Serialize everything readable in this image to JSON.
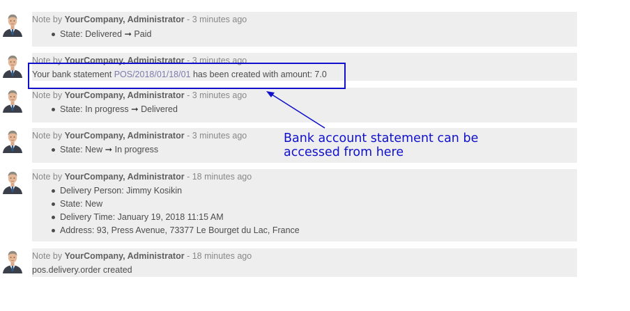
{
  "messages": [
    {
      "prefix": "Note by",
      "author": "YourCompany, Administrator",
      "separator": " - ",
      "time": "3 minutes ago",
      "tracking": [
        {
          "label": "State:",
          "old": "Delivered",
          "arrow": "➞",
          "new": "Paid"
        }
      ]
    },
    {
      "prefix": "Note by",
      "author": "YourCompany, Administrator",
      "separator": " - ",
      "time": "3 minutes ago",
      "body": {
        "before": "Your bank statement",
        "link": "POS/2018/01/18/01",
        "after": "has been created with amount: 7.0"
      }
    },
    {
      "prefix": "Note by",
      "author": "YourCompany, Administrator",
      "separator": " - ",
      "time": "3 minutes ago",
      "tracking": [
        {
          "label": "State:",
          "old": "In progress",
          "arrow": "➞",
          "new": "Delivered"
        }
      ]
    },
    {
      "prefix": "Note by",
      "author": "YourCompany, Administrator",
      "separator": " - ",
      "time": "3 minutes ago",
      "tracking": [
        {
          "label": "State:",
          "old": "New",
          "arrow": "➞",
          "new": "In progress"
        }
      ]
    },
    {
      "prefix": "Note by",
      "author": "YourCompany, Administrator",
      "separator": " - ",
      "time": "18 minutes ago",
      "items": [
        "Delivery Person: Jimmy Kosikin",
        "State: New",
        "Delivery Time: January 19, 2018 11:15 AM",
        "Address: 93, Press Avenue, 73377 Le Bourget du Lac, France"
      ]
    },
    {
      "prefix": "Note by",
      "author": "YourCompany, Administrator",
      "separator": " - ",
      "time": "18 minutes ago",
      "body_plain": "pos.delivery.order created"
    }
  ],
  "annotation": {
    "text": "Bank account statement can be\naccessed from here",
    "color": "#1010cc"
  },
  "colors": {
    "bubble": "#eeeeee",
    "link": "#7c7bad",
    "meta": "#888888"
  },
  "icons": {
    "avatar": "user-avatar-icon",
    "arrow": "arrow-right-icon"
  }
}
